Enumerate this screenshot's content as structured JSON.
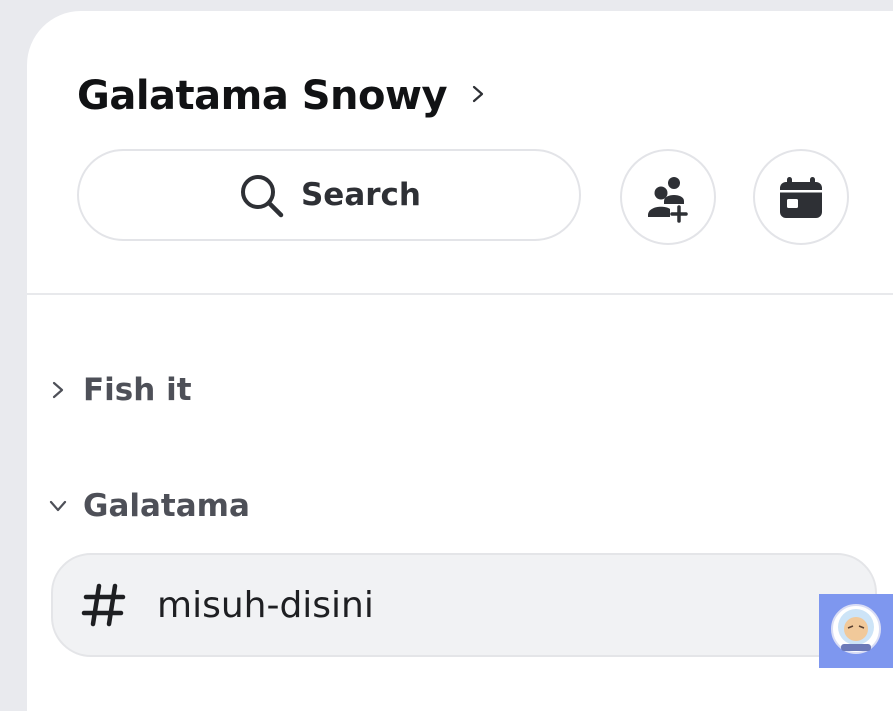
{
  "server": {
    "name": "Galatama Snowy",
    "chevron_icon": "chevron-right-icon"
  },
  "search": {
    "label": "Search",
    "icon": "search-icon"
  },
  "actions": {
    "invite_icon": "add-member-icon",
    "events_icon": "calendar-icon"
  },
  "categories": [
    {
      "label": "Fish it",
      "state": "collapsed"
    },
    {
      "label": "Galatama",
      "state": "expanded"
    }
  ],
  "channels": [
    {
      "label": "misuh-disini",
      "icon": "hashtag-icon",
      "selected": true
    }
  ],
  "colors": {
    "background": "#e9eaee",
    "panel": "#ffffff",
    "selected_channel": "#f1f2f4",
    "text_primary": "#111214",
    "text_muted": "#4e5058"
  }
}
